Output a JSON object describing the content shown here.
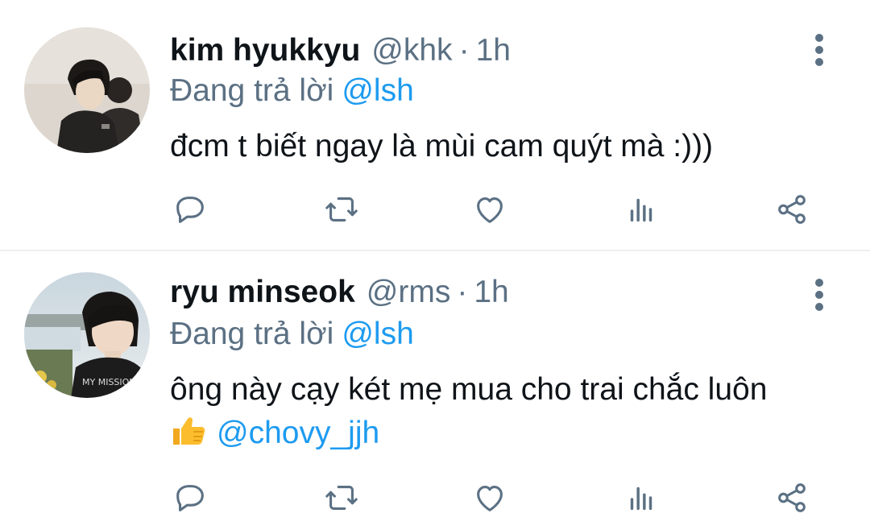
{
  "tweets": [
    {
      "display_name": "kim hyukkyu",
      "handle": "@khk",
      "separator": "·",
      "time": "1h",
      "reply_prefix": "Đang trả lời",
      "reply_to": "@lsh",
      "text": "đcm t biết ngay là mùi cam quýt mà :)))",
      "avatar_icon": "avatar-photo"
    },
    {
      "display_name": "ryu minseok",
      "handle": "@rms",
      "separator": "·",
      "time": "1h",
      "reply_prefix": "Đang trả lời",
      "reply_to": "@lsh",
      "text_line1": "ông này cạy két mẹ mua cho trai chắc luôn",
      "text_emoji": "thumbs-up",
      "text_mention": "@chovy_jjh",
      "avatar_icon": "avatar-photo"
    }
  ],
  "actions": [
    "reply-icon",
    "retweet-icon",
    "like-icon",
    "analytics-icon",
    "share-icon"
  ],
  "colors": {
    "name": "#0f1419",
    "secondary": "#5b7083",
    "link": "#1d9bf0",
    "divider": "#eceff1"
  }
}
